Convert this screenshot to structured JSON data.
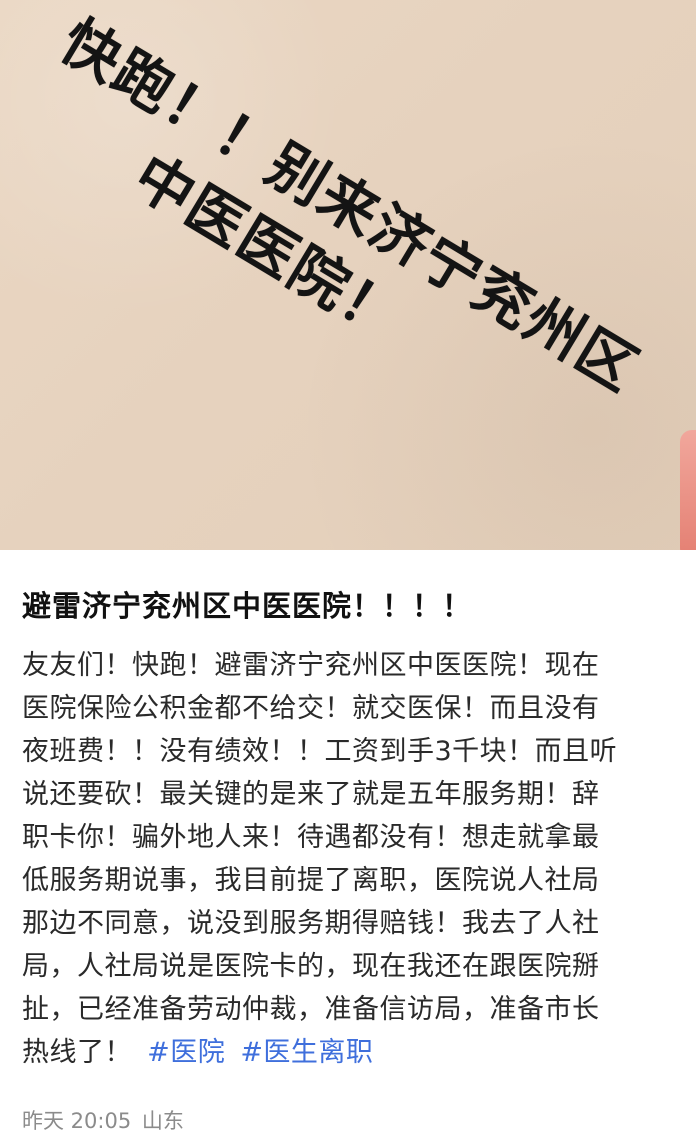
{
  "poster": {
    "line1": "快跑！！别来济宁兖州区",
    "line2": "中医医院！"
  },
  "post": {
    "title": "避雷济宁兖州区中医医院！！！！",
    "body_lines": [
      "友友们！快跑！避雷济宁兖州区中医医院！现在",
      "医院保险公积金都不给交！就交医保！而且没有",
      "夜班费！！没有绩效！！工资到手3千块！而且听",
      "说还要砍！最关键的是来了就是五年服务期！辞",
      "职卡你！骗外地人来！待遇都没有！想走就拿最",
      "低服务期说事，我目前提了离职，医院说人社局",
      "那边不同意，说没到服务期得赔钱！我去了人社",
      "局，人社局说是医院卡的，现在我还在跟医院掰",
      "扯，已经准备劳动仲裁，准备信访局，准备市长",
      "热线了！"
    ],
    "hashtags": [
      "#医院",
      "#医生离职"
    ],
    "meta": {
      "time": "昨天 20:05",
      "location": "山东"
    }
  }
}
